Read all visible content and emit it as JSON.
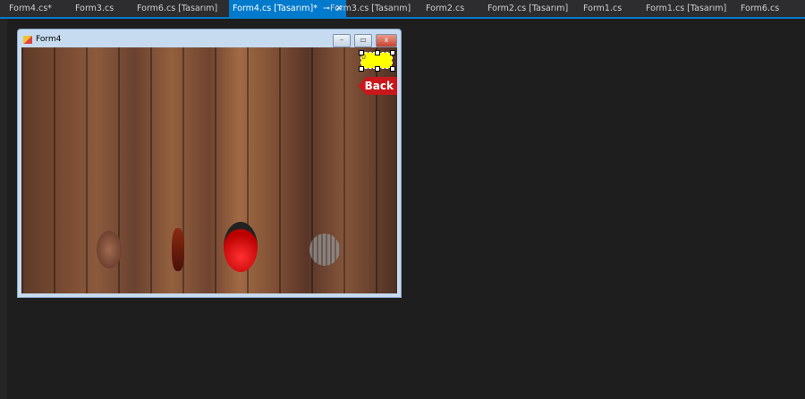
{
  "tabs": [
    {
      "label": "Form4.cs*"
    },
    {
      "label": "Form3.cs"
    },
    {
      "label": "Form6.cs [Tasarım]"
    },
    {
      "label": "Form4.cs [Tasarım]*",
      "active": true
    },
    {
      "label": "Form3.cs [Tasarım]"
    },
    {
      "label": "Form2.cs"
    },
    {
      "label": "Form2.cs [Tasarım]"
    },
    {
      "label": "Form1.cs"
    },
    {
      "label": "Form1.cs [Tasarım]"
    },
    {
      "label": "Form6.cs"
    }
  ],
  "tab_icons": {
    "pin": "⊸",
    "close": "✕"
  },
  "form": {
    "title": "Form4",
    "minimize": "–",
    "maximize": "▭",
    "close": "x",
    "score": "0",
    "back_label": "Back"
  },
  "colors": {
    "accent": "#007acc",
    "score_bg": "#ffff00",
    "back_bg": "#c8181c"
  }
}
